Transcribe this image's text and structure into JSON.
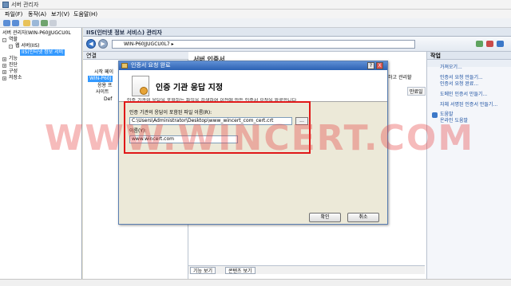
{
  "app": {
    "title": "서버 관리자"
  },
  "menu": {
    "file": "파일(F)",
    "action": "동작(A)",
    "view": "보기(V)",
    "help": "도움말(H)"
  },
  "tree": {
    "root": "서버 관리자(WIN-P60JJUGCU0L",
    "roles": "역할",
    "web_server": "웹 서버(IIS)",
    "iis_manager": "IIS(인터넷 정보 서비",
    "features": "기능",
    "diagnostics": "진단",
    "configuration": "구성",
    "storage": "저장소"
  },
  "iis_bar": {
    "title": "IIS(인터넷 정보 서비스) 관리자"
  },
  "address": {
    "path": "WIN-P60JJUGCU0L7 ▸"
  },
  "connections": {
    "header": "연결",
    "items": [
      "시작 페이",
      "WIN-P60J",
      "응용 프",
      "사이트",
      "Def"
    ]
  },
  "main": {
    "heading": "서버 인증서",
    "snippet": "하고 관리할",
    "col_header": "만료일"
  },
  "view_tabs": {
    "features": "기능 보기",
    "content": "콘텐츠 보기"
  },
  "actions": {
    "header": "작업",
    "sub": "",
    "links": [
      "가져오기...",
      "인증서 요청 만들기...",
      "인증서 요청 완료...",
      "도메인 인증서 만들기...",
      "자체 서명된 인증서 만들기...",
      "도움말",
      "온라인 도움말"
    ]
  },
  "dialog": {
    "title": "인증서 요청 완료",
    "help_btn": "?",
    "close_btn": "X",
    "heading": "인증 기관 응답 지정",
    "description": "인증 기관의 응답을 포함하는 파일을 검색하여 이전에 만든 인증서 요청을 완료합니다.",
    "file_label": "인증 기관의 응답이 포함된 파일 이름(R):",
    "file_value": "C:\\Users\\Administrator\\Desktop\\www_wincert_com_cert.crt",
    "browse_label": "...",
    "name_label": "이름(Y):",
    "name_value": "www.wincert.com",
    "ok": "확인",
    "cancel": "취소"
  },
  "watermark": "WWW.WINCERT.COM",
  "colors": {
    "accent": "#2c62b4",
    "highlight": "#e01818",
    "link": "#1a4fa0"
  }
}
